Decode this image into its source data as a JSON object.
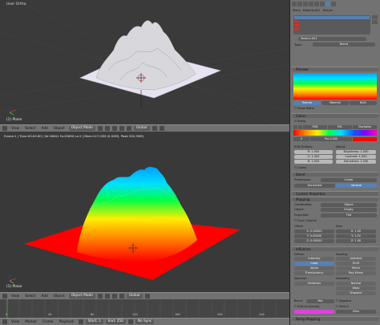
{
  "top_view": {
    "title": "User Ortho",
    "object_label": "(1) Plane"
  },
  "top_header": {
    "menus": [
      "View",
      "Select",
      "Add",
      "Object"
    ],
    "mode": "Object Mode",
    "orientation": "Global"
  },
  "bottom_view": {
    "info": "Frame:1 | Time:00:00.80 | Ve:16641 Fa:25690 La:1 | Mem:117.03M (0.50M), Peak 552.59M)",
    "object_label": "(1) Plane"
  },
  "bottom_header": {
    "menus": [
      "View",
      "Select",
      "Add",
      "Object"
    ],
    "mode": "Object Mode",
    "orientation": "Global"
  },
  "timeline": {
    "menus": [
      "View",
      "Marker",
      "Frame",
      "Playback"
    ],
    "start": "Start:",
    "start_val": "1",
    "end": "End:",
    "end_val": "250",
    "sync": "No Sync",
    "ticks": [
      "0",
      "40",
      "80",
      "120",
      "160",
      "200",
      "240"
    ]
  },
  "properties": {
    "breadcrumb": [
      "Plane",
      "Material.001",
      "Texture"
    ],
    "texture_name": "Texture.001",
    "type_label": "Type:",
    "type_value": "Blend",
    "preview_label": "Preview",
    "preview_tabs": [
      "Texture",
      "Material",
      "Both"
    ],
    "show_alpha": "Show Alpha",
    "colors_label": "Colors",
    "ramp_label": "Ramp",
    "ramp_mode": "RGB",
    "ramp_interp": "Linear",
    "ramp_color_mode": "HSL",
    "ramp_dir": "Clockwise",
    "pos_label": "Pos",
    "pos_value": "0.000",
    "rgb_mult": "RGB Multiply:",
    "adjust": "Adjust:",
    "r": "R",
    "r_val": "1.000",
    "g": "G",
    "g_val": "1.000",
    "b": "B",
    "b_val": "1.000",
    "brightness": "Brightness:",
    "brightness_val": "1.000",
    "contrast": "Contrast:",
    "contrast_val": "1.000",
    "saturation": "Saturation:",
    "saturation_val": "1.000",
    "clamp": "Clamp",
    "blend_label": "Blend",
    "progression": "Progression:",
    "progression_val": "Linear",
    "horizontal": "Horizontal",
    "vertical": "Vertical",
    "custom_props": "Custom Properties",
    "mapping": "Mapping",
    "coordinates": "Coordinates:",
    "coordinates_val": "Object",
    "object": "Object:",
    "object_val": "Empty",
    "projection": "Projection:",
    "projection_val": "Flat",
    "from_original": "From Original",
    "offset": "Offset:",
    "size": "Size:",
    "ox": "X",
    "ox_val": "0.00000",
    "oy": "Y",
    "oy_val": "0.00000",
    "oz": "Z",
    "oz_val": "0.00000",
    "sx": "X",
    "sx_val": "1.00",
    "sy": "Y",
    "sy_val": "1.00",
    "sz": "Z",
    "sz_val": "1.00",
    "influence": "Influence",
    "diffuse": "Diffuse:",
    "shading": "Shading:",
    "intensity": "Intensity",
    "color": "Color",
    "alpha": "Alpha",
    "translucency": "Translucency",
    "ambient": "Ambient",
    "emit": "Emit",
    "mirror": "Mirror",
    "ray_mirror": "Ray Mirror",
    "specular": "Specular:",
    "geometry": "Geometry:",
    "hardness": "Hardness",
    "normal": "Normal",
    "warp": "Warp",
    "displace": "Displace",
    "blend_mode_label": "Blend:",
    "blend_mode_val": "Mix",
    "negative": "Negative",
    "rgb_to_intensity": "RGB to Intensity",
    "stencil": "Stencil",
    "dvar": "DVar",
    "bump_mapping": "Bump Mapping"
  },
  "colors": {
    "viewport_bg": "#393939",
    "accent_blue": "#5780b3",
    "plane_top": "#e6e1ee",
    "plane_bottom": "#ff0000",
    "pink": "#e040e0"
  }
}
